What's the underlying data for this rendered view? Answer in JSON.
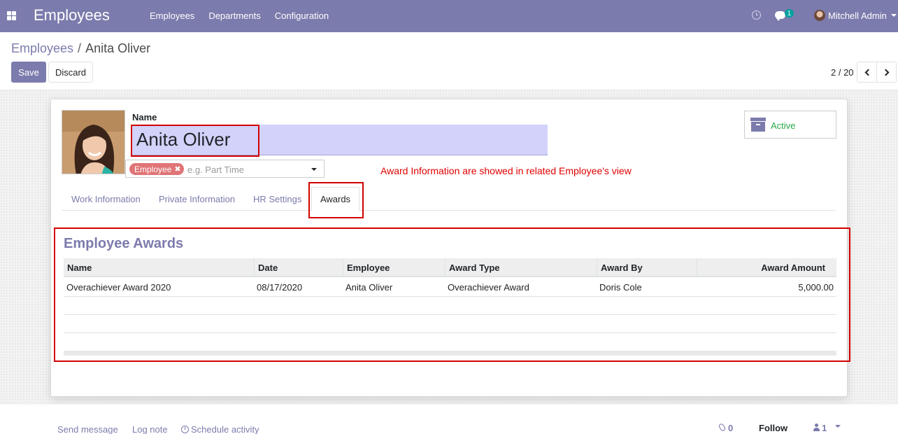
{
  "navbar": {
    "app_title": "Employees",
    "menu": [
      "Employees",
      "Departments",
      "Configuration"
    ],
    "messages_badge": "1",
    "user_name": "Mitchell Admin"
  },
  "breadcrumb": {
    "parent": "Employees",
    "separator": "/",
    "current": "Anita Oliver"
  },
  "toolbar": {
    "save_label": "Save",
    "discard_label": "Discard",
    "pager": "2 / 20"
  },
  "employee": {
    "name_label": "Name",
    "name_value": "Anita Oliver",
    "tag": "Employee",
    "tags_placeholder": "e.g. Part Time",
    "status": "Active"
  },
  "annotation": "Award Information are showed in related Employee's view",
  "tabs": [
    "Work Information",
    "Private Information",
    "HR Settings",
    "Awards"
  ],
  "awards": {
    "title": "Employee Awards",
    "columns": [
      "Name",
      "Date",
      "Employee",
      "Award Type",
      "Award By",
      "Award Amount"
    ],
    "rows": [
      [
        "Overachiever Award 2020",
        "08/17/2020",
        "Anita Oliver",
        "Overachiever Award",
        "Doris Cole",
        "5,000.00"
      ]
    ]
  },
  "chatter": {
    "send_message": "Send message",
    "log_note": "Log note",
    "schedule_activity": "Schedule activity",
    "attachments": "0",
    "follow": "Follow",
    "followers": "1"
  },
  "colors": {
    "brand": "#7c7bad",
    "highlight": "#d20000",
    "active": "#28a745",
    "tag": "#e07476"
  }
}
